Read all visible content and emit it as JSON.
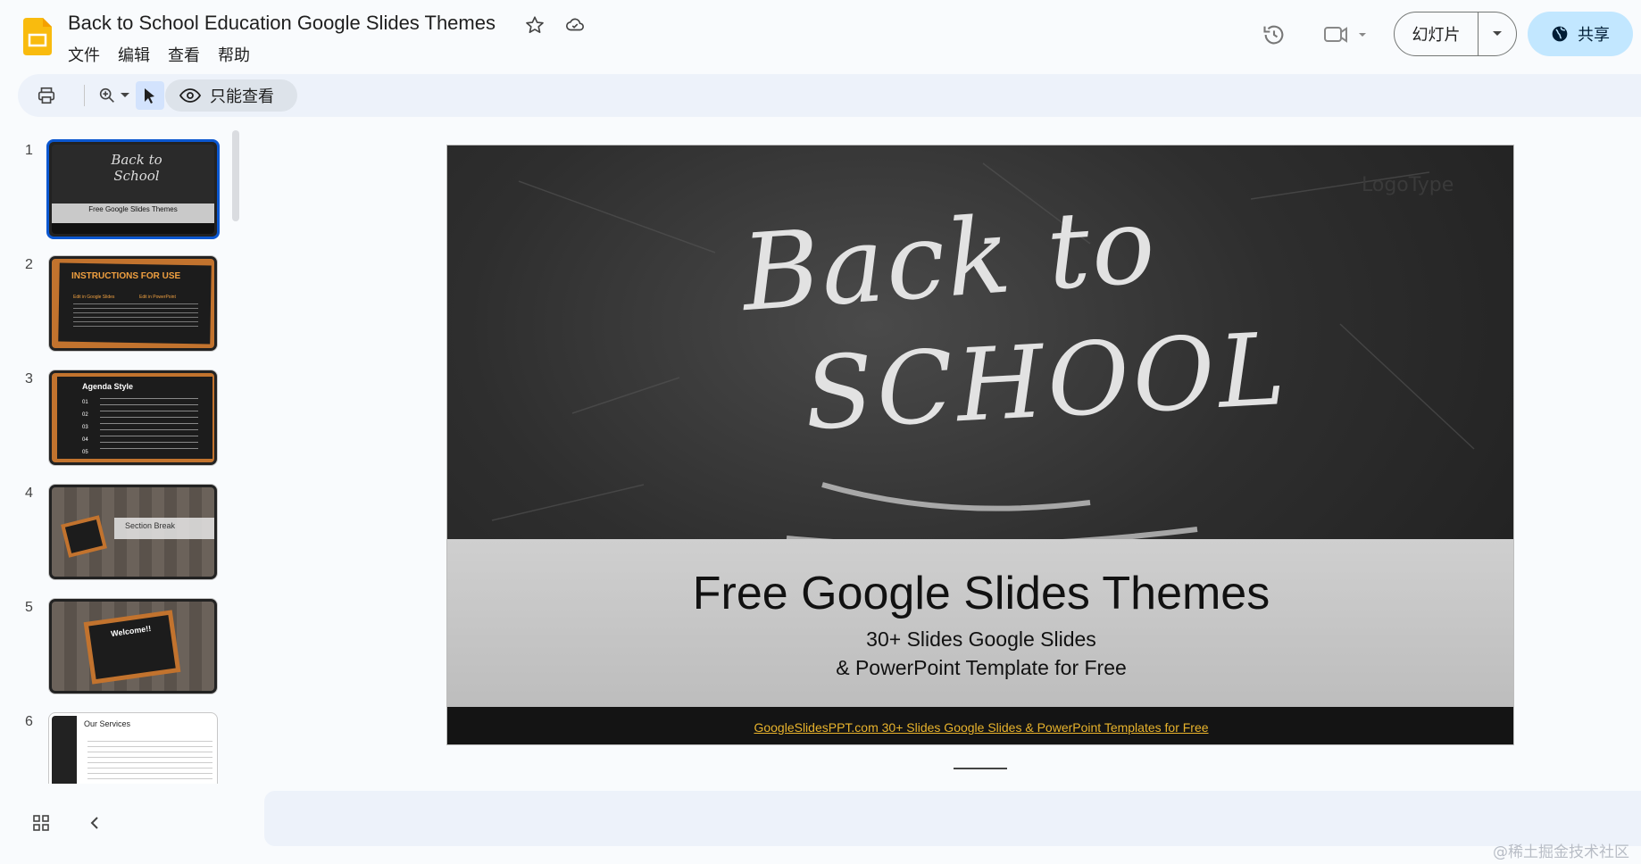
{
  "header": {
    "doc_title": "Back to School Education Google Slides Themes",
    "menu": [
      "文件",
      "编辑",
      "查看",
      "帮助"
    ],
    "slideshow_label": "幻灯片",
    "share_label": "共享",
    "accent_color": "#c2e7ff"
  },
  "toolbar": {
    "view_only_label": "只能查看"
  },
  "filmstrip": {
    "slides": [
      {
        "num": "1",
        "title": "Back to School",
        "caption": "Free Google Slides Themes",
        "selected": true
      },
      {
        "num": "2",
        "title": "INSTRUCTIONS FOR USE",
        "sub_left": "Edit in Google Slides",
        "sub_right": "Edit in PowerPoint"
      },
      {
        "num": "3",
        "title": "Agenda Style",
        "items": [
          "01",
          "02",
          "03",
          "04",
          "05"
        ]
      },
      {
        "num": "4",
        "title": "Section Break"
      },
      {
        "num": "5",
        "title": "Welcome!!"
      },
      {
        "num": "6",
        "title": "Our Services"
      }
    ]
  },
  "slide": {
    "chalk_line1": "Back to",
    "chalk_line2": "SCHOOL",
    "logo": "LogoType",
    "title": "Free Google Slides Themes",
    "subtitle1": "30+ Slides Google Slides",
    "subtitle2": "& PowerPoint Template for Free",
    "footer": "GoogleSlidesPPT.com   30+ Slides Google Slides & PowerPoint Templates for Free"
  },
  "watermark": "@稀土掘金技术社区"
}
